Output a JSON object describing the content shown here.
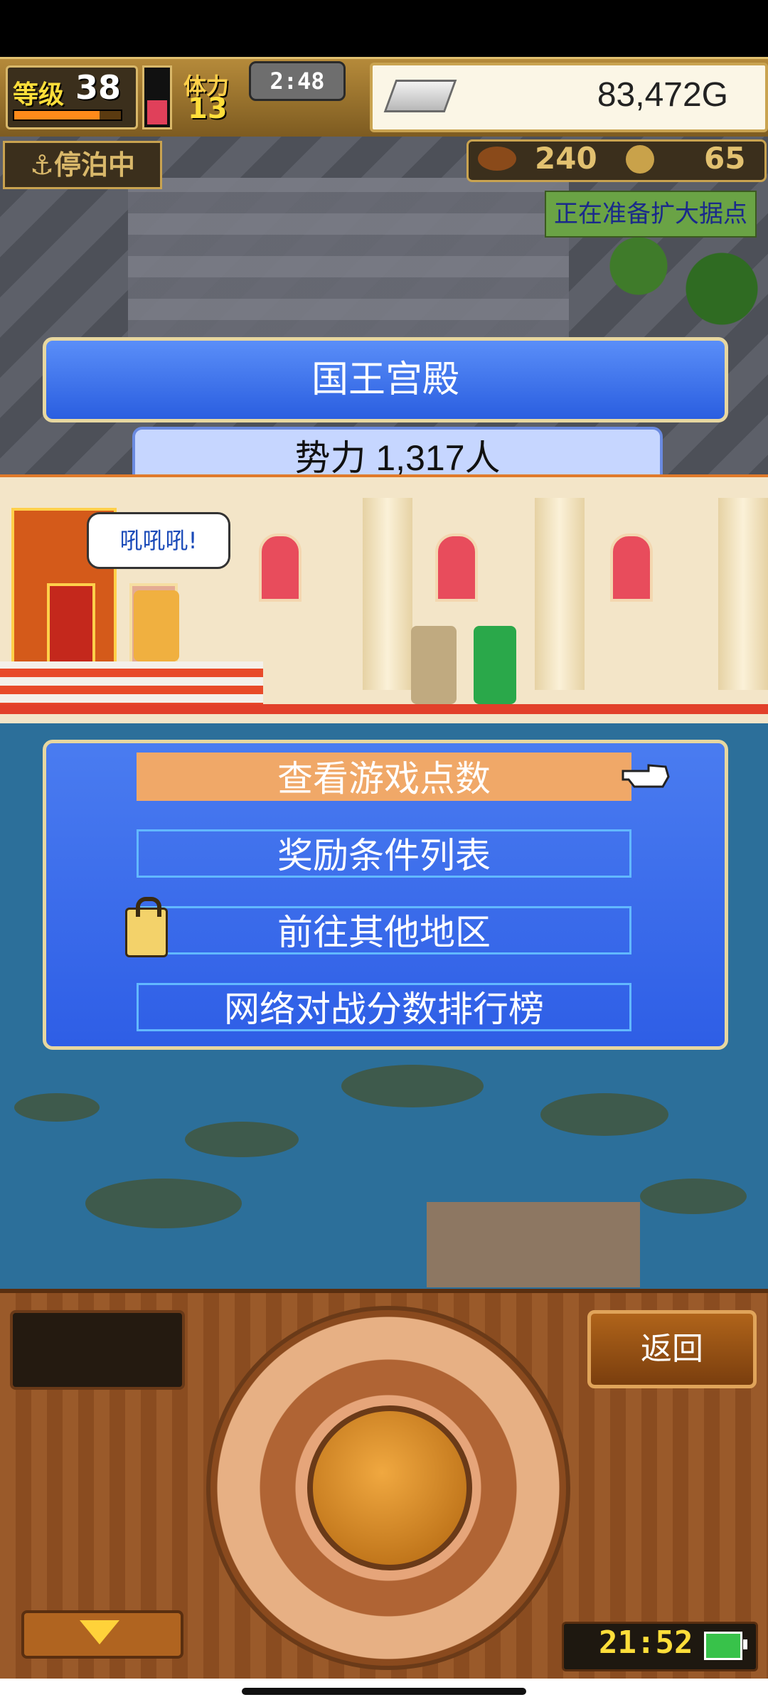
{
  "hud": {
    "level_label": "等级",
    "level": "38",
    "level_progress": 0.8,
    "stamina_label": "体力",
    "stamina": "13",
    "stamina_fill": 0.45,
    "timer": "2:48",
    "gold": "83,472G"
  },
  "status": {
    "moored": "停泊中",
    "resource1": "240",
    "resource2": "65",
    "preparing": "正在准备扩大据点"
  },
  "location": {
    "name": "国王宫殿",
    "power": "势力  1,317人"
  },
  "king_speech": "吼吼吼!",
  "menu": {
    "items": [
      {
        "label": "查看游戏点数",
        "selected": true
      },
      {
        "label": "奖励条件列表",
        "selected": false
      },
      {
        "label": "前往其他地区",
        "selected": false,
        "locked": true
      },
      {
        "label": "网络对战分数排行榜",
        "selected": false
      }
    ]
  },
  "controls": {
    "back_label": "返回",
    "clock": "21:52"
  },
  "colors": {
    "menu_blue": "#2e5ee6",
    "selected_item": "#f0a868",
    "wood": "#9a5a2a"
  },
  "icons": [
    "silver-ingot-icon",
    "anchor-icon",
    "meat-icon",
    "coin-icon",
    "pointing-hand-icon",
    "lock-icon",
    "down-arrow-icon",
    "battery-icon"
  ]
}
